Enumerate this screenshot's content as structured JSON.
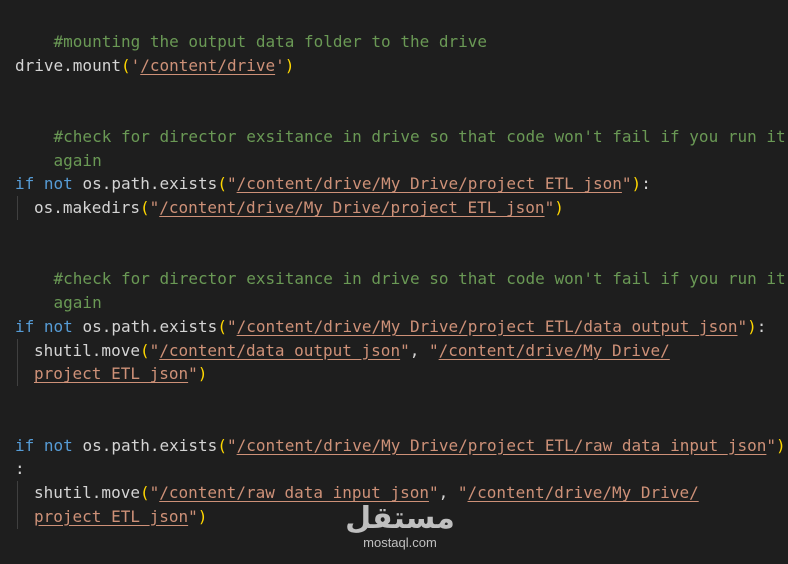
{
  "editor": {
    "lines": {
      "l1": "#mounting the output data folder to the drive",
      "l3_call": "drive.mount",
      "l3_open": "(",
      "l3_q1": "'",
      "l3_path": "/content/drive",
      "l3_q2": "'",
      "l3_close": ")",
      "l5": "#check for director exsitance in drive so that code won't fail if you run it",
      "l6": "again",
      "l8_kw1": "if",
      "l8_kw2": "not",
      "l8_call": "os.path.exists",
      "l8_open": "(",
      "l8_q1": "\"",
      "l8_path": "/content/drive/My Drive/project_ETL_json",
      "l8_q2": "\"",
      "l8_close": ")",
      "l8_colon": ":",
      "l9_call": "os.makedirs",
      "l9_open": "(",
      "l9_q1": "\"",
      "l9_path": "/content/drive/My Drive/project_ETL_json",
      "l9_q2": "\"",
      "l9_close": ")",
      "l11": "#check for director exsitance in drive so that code won't fail if you run it",
      "l12": "again",
      "l14_kw1": "if",
      "l14_kw2": "not",
      "l14_call": "os.path.exists",
      "l14_open": "(",
      "l14_q1": "\"",
      "l14_path": "/content/drive/My Drive/project_ETL/data_output_json",
      "l14_q2": "\"",
      "l14_close": ")",
      "l14_colon": ":",
      "l15_call": "shutil.move",
      "l15_open": "(",
      "l15_q1": "\"",
      "l15_path1": "/content/data_output_json",
      "l15_q2": "\"",
      "l15_sep": ", ",
      "l15_q3": "\"",
      "l15_path2": "/content/drive/My Drive/",
      "l16_path": "project_ETL_json",
      "l16_q": "\"",
      "l16_close": ")",
      "l19_kw1": "if",
      "l19_kw2": "not",
      "l19_call": "os.path.exists",
      "l19_open": "(",
      "l19_q1": "\"",
      "l19_path": "/content/drive/My Drive/project_ETL/raw_data_input_json",
      "l19_q2": "\"",
      "l19_close": ")",
      "l20_colon": ":",
      "l21_call": "shutil.move",
      "l21_open": "(",
      "l21_q1": "\"",
      "l21_path1": "/content/raw_data_input_json",
      "l21_q2": "\"",
      "l21_sep": ", ",
      "l21_q3": "\"",
      "l21_path2": "/content/drive/My Drive/",
      "l22_path": "project_ETL_json",
      "l22_q": "\"",
      "l22_close": ")"
    }
  },
  "watermark": {
    "logo": "مستقل",
    "domain": "mostaql.com"
  },
  "colors": {
    "background": "#1e1e1e",
    "comment": "#6a9955",
    "keyword": "#569cd6",
    "string": "#ce9178",
    "function": "#dcdcaa",
    "bracket": "#ffd700"
  }
}
